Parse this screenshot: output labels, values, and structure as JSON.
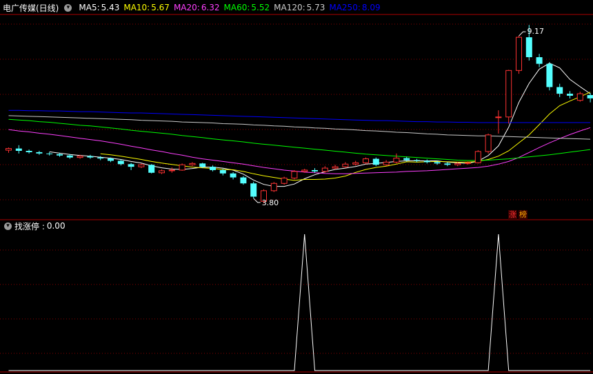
{
  "header": {
    "title": "电广传媒(日线)",
    "ma": [
      {
        "label": "MA5:",
        "value": "5.43",
        "color": "#ffffff"
      },
      {
        "label": "MA10:",
        "value": "5.67",
        "color": "#ffff00"
      },
      {
        "label": "MA20:",
        "value": "6.32",
        "color": "#ff40ff"
      },
      {
        "label": "MA60:",
        "value": "5.52",
        "color": "#00ff00"
      },
      {
        "label": "MA120:",
        "value": "5.73",
        "color": "#cccccc"
      },
      {
        "label": "MA250:",
        "value": "8.09",
        "color": "#0000ff"
      }
    ]
  },
  "indicator": {
    "label": "找涨停 :",
    "value": "0.00"
  },
  "badges": [
    {
      "text": "涨",
      "color": "#ff3030"
    },
    {
      "text": "榜",
      "color": "#ffaa00"
    }
  ],
  "colors": {
    "up": "#ff3232",
    "down": "#54ffff",
    "grid": "#8b0000",
    "border": "#aa0000"
  },
  "chart_data": [
    {
      "type": "candlestick",
      "title": "电广传媒(日线)",
      "annotations": [
        {
          "text": "9.17",
          "x": 50
        },
        {
          "text": "3.80",
          "x": 24
        }
      ],
      "candles": [
        [
          5.4,
          5.45,
          5.48,
          5.32
        ],
        [
          5.45,
          5.38,
          5.55,
          5.3
        ],
        [
          5.38,
          5.34,
          5.42,
          5.3
        ],
        [
          5.34,
          5.3,
          5.38,
          5.26
        ],
        [
          5.3,
          5.28,
          5.34,
          5.24
        ],
        [
          5.28,
          5.24,
          5.32,
          5.2
        ],
        [
          5.24,
          5.18,
          5.28,
          5.14
        ],
        [
          5.18,
          5.22,
          5.26,
          5.14
        ],
        [
          5.22,
          5.18,
          5.26,
          5.14
        ],
        [
          5.18,
          5.15,
          5.22,
          5.1
        ],
        [
          5.15,
          5.08,
          5.18,
          5.04
        ],
        [
          5.08,
          4.98,
          5.12,
          4.94
        ],
        [
          4.98,
          4.9,
          5.02,
          4.8
        ],
        [
          4.9,
          4.96,
          5.0,
          4.86
        ],
        [
          4.96,
          4.72,
          4.98,
          4.7
        ],
        [
          4.72,
          4.78,
          4.82,
          4.68
        ],
        [
          4.78,
          4.8,
          4.88,
          4.72
        ],
        [
          4.8,
          4.96,
          5.0,
          4.78
        ],
        [
          4.96,
          5.0,
          5.04,
          4.92
        ],
        [
          5.0,
          4.9,
          5.02,
          4.86
        ],
        [
          4.9,
          4.8,
          4.94,
          4.76
        ],
        [
          4.8,
          4.7,
          4.84,
          4.64
        ],
        [
          4.7,
          4.58,
          4.74,
          4.52
        ],
        [
          4.58,
          4.4,
          4.62,
          4.36
        ],
        [
          4.4,
          4.0,
          4.45,
          3.95
        ],
        [
          3.86,
          4.18,
          4.22,
          3.8
        ],
        [
          4.18,
          4.4,
          4.44,
          4.14
        ],
        [
          4.4,
          4.56,
          4.6,
          4.36
        ],
        [
          4.56,
          4.76,
          4.8,
          4.52
        ],
        [
          4.76,
          4.8,
          4.84,
          4.72
        ],
        [
          4.8,
          4.76,
          4.86,
          4.72
        ],
        [
          4.76,
          4.86,
          4.92,
          4.72
        ],
        [
          4.86,
          4.9,
          4.96,
          4.82
        ],
        [
          4.9,
          4.98,
          5.04,
          4.86
        ],
        [
          4.98,
          5.02,
          5.08,
          4.94
        ],
        [
          5.02,
          5.14,
          5.18,
          4.98
        ],
        [
          5.14,
          4.96,
          5.18,
          4.92
        ],
        [
          4.96,
          5.04,
          5.1,
          4.92
        ],
        [
          5.04,
          5.16,
          5.3,
          5.0
        ],
        [
          5.16,
          5.1,
          5.2,
          5.06
        ],
        [
          5.1,
          5.08,
          5.14,
          5.04
        ],
        [
          5.08,
          5.04,
          5.12,
          5.0
        ],
        [
          5.04,
          5.0,
          5.08,
          4.96
        ],
        [
          5.0,
          4.96,
          5.04,
          4.92
        ],
        [
          4.96,
          5.0,
          5.04,
          4.92
        ],
        [
          5.0,
          5.02,
          5.06,
          4.96
        ],
        [
          5.02,
          5.36,
          5.4,
          5.0
        ],
        [
          5.36,
          5.86,
          5.9,
          5.3
        ],
        [
          6.4,
          6.4,
          6.6,
          5.9
        ],
        [
          6.4,
          7.8,
          7.82,
          6.2
        ],
        [
          7.8,
          8.8,
          8.84,
          7.7
        ],
        [
          8.8,
          8.2,
          9.17,
          8.1
        ],
        [
          8.2,
          8.0,
          8.3,
          7.9
        ],
        [
          8.0,
          7.3,
          8.05,
          7.2
        ],
        [
          7.3,
          7.1,
          7.4,
          7.0
        ],
        [
          7.1,
          7.04,
          7.18,
          6.96
        ],
        [
          6.9,
          7.1,
          7.16,
          6.86
        ],
        [
          7.06,
          6.96,
          7.12,
          6.84
        ]
      ],
      "ma": [
        {
          "name": "MA5",
          "color": "#ffffff",
          "values": [
            null,
            null,
            null,
            null,
            5.35,
            5.31,
            5.27,
            5.24,
            5.22,
            5.19,
            5.16,
            5.12,
            5.06,
            5.01,
            4.93,
            4.87,
            4.83,
            4.82,
            4.85,
            4.89,
            4.89,
            4.86,
            4.8,
            4.68,
            4.5,
            4.37,
            4.31,
            4.31,
            4.38,
            4.54,
            4.66,
            4.75,
            4.82,
            4.86,
            4.91,
            4.98,
            5.0,
            5.03,
            5.06,
            5.08,
            5.08,
            5.08,
            5.08,
            5.04,
            5.02,
            5.0,
            5.07,
            5.24,
            5.53,
            6.09,
            6.84,
            7.41,
            7.84,
            8.02,
            7.88,
            7.53,
            7.31,
            7.1
          ]
        },
        {
          "name": "MA10",
          "color": "#ffff00",
          "values": [
            null,
            null,
            null,
            null,
            null,
            null,
            null,
            null,
            null,
            5.29,
            5.26,
            5.22,
            5.17,
            5.12,
            5.06,
            5.01,
            4.97,
            4.93,
            4.89,
            4.87,
            4.85,
            4.82,
            4.81,
            4.76,
            4.69,
            4.63,
            4.58,
            4.53,
            4.49,
            4.52,
            4.52,
            4.53,
            4.56,
            4.62,
            4.73,
            4.82,
            4.88,
            4.92,
            4.98,
            5.05,
            5.04,
            5.05,
            5.06,
            5.05,
            5.04,
            5.04,
            5.06,
            5.12,
            5.22,
            5.38,
            5.62,
            5.86,
            6.17,
            6.49,
            6.74,
            6.88,
            7.01,
            7.15
          ]
        },
        {
          "name": "MA20",
          "color": "#ff40ff",
          "values": [
            6.02,
            5.98,
            5.95,
            5.91,
            5.88,
            5.84,
            5.8,
            5.76,
            5.72,
            5.68,
            5.63,
            5.58,
            5.52,
            5.47,
            5.41,
            5.36,
            5.3,
            5.25,
            5.19,
            5.14,
            5.1,
            5.06,
            5.02,
            4.98,
            4.93,
            4.88,
            4.84,
            4.8,
            4.77,
            4.74,
            4.72,
            4.7,
            4.69,
            4.69,
            4.7,
            4.71,
            4.72,
            4.73,
            4.74,
            4.76,
            4.77,
            4.78,
            4.8,
            4.82,
            4.84,
            4.86,
            4.88,
            4.92,
            4.98,
            5.06,
            5.18,
            5.33,
            5.48,
            5.62,
            5.75,
            5.87,
            5.98,
            6.08
          ]
        },
        {
          "name": "MA60",
          "color": "#00ff00",
          "values": [
            6.33,
            6.31,
            6.29,
            6.26,
            6.24,
            6.21,
            6.18,
            6.15,
            6.13,
            6.1,
            6.07,
            6.04,
            6.0,
            5.97,
            5.94,
            5.91,
            5.88,
            5.84,
            5.81,
            5.78,
            5.74,
            5.71,
            5.68,
            5.65,
            5.61,
            5.58,
            5.55,
            5.52,
            5.49,
            5.46,
            5.43,
            5.4,
            5.37,
            5.34,
            5.31,
            5.28,
            5.26,
            5.24,
            5.22,
            5.2,
            5.18,
            5.16,
            5.14,
            5.12,
            5.1,
            5.09,
            5.09,
            5.1,
            5.12,
            5.14,
            5.17,
            5.2,
            5.23,
            5.26,
            5.3,
            5.34,
            5.38,
            5.42
          ]
        },
        {
          "name": "MA120",
          "color": "#cccccc",
          "values": [
            6.44,
            6.43,
            6.42,
            6.41,
            6.4,
            6.39,
            6.38,
            6.37,
            6.36,
            6.35,
            6.34,
            6.33,
            6.32,
            6.3,
            6.29,
            6.28,
            6.27,
            6.25,
            6.24,
            6.23,
            6.22,
            6.2,
            6.19,
            6.18,
            6.16,
            6.15,
            6.13,
            6.12,
            6.1,
            6.09,
            6.07,
            6.06,
            6.04,
            6.03,
            6.01,
            5.99,
            5.98,
            5.96,
            5.94,
            5.93,
            5.91,
            5.89,
            5.88,
            5.86,
            5.85,
            5.84,
            5.83,
            5.83,
            5.82,
            5.81,
            5.8,
            5.79,
            5.78,
            5.77,
            5.76,
            5.75,
            5.74,
            5.73
          ]
        },
        {
          "name": "MA250",
          "color": "#0000ff",
          "values": [
            6.6,
            6.6,
            6.59,
            6.59,
            6.58,
            6.58,
            6.57,
            6.56,
            6.56,
            6.55,
            6.54,
            6.53,
            6.52,
            6.52,
            6.51,
            6.5,
            6.49,
            6.48,
            6.47,
            6.46,
            6.45,
            6.44,
            6.43,
            6.42,
            6.41,
            6.4,
            6.39,
            6.38,
            6.37,
            6.36,
            6.35,
            6.34,
            6.33,
            6.32,
            6.31,
            6.3,
            6.29,
            6.29,
            6.28,
            6.27,
            6.26,
            6.26,
            6.25,
            6.25,
            6.24,
            6.24,
            6.23,
            6.23,
            6.23,
            6.23,
            6.23,
            6.23,
            6.23,
            6.23,
            6.23,
            6.23,
            6.23,
            6.23
          ]
        }
      ]
    },
    {
      "type": "line",
      "title": "找涨停",
      "color": "#ffffff",
      "values": [
        0,
        0,
        0,
        0,
        0,
        0,
        0,
        0,
        0,
        0,
        0,
        0,
        0,
        0,
        0,
        0,
        0,
        0,
        0,
        0,
        0,
        0,
        0,
        0,
        0,
        0,
        0,
        0,
        0,
        1,
        0,
        0,
        0,
        0,
        0,
        0,
        0,
        0,
        0,
        0,
        0,
        0,
        0,
        0,
        0,
        0,
        0,
        0,
        1,
        0,
        0,
        0,
        0,
        0,
        0,
        0,
        0,
        0
      ]
    }
  ]
}
